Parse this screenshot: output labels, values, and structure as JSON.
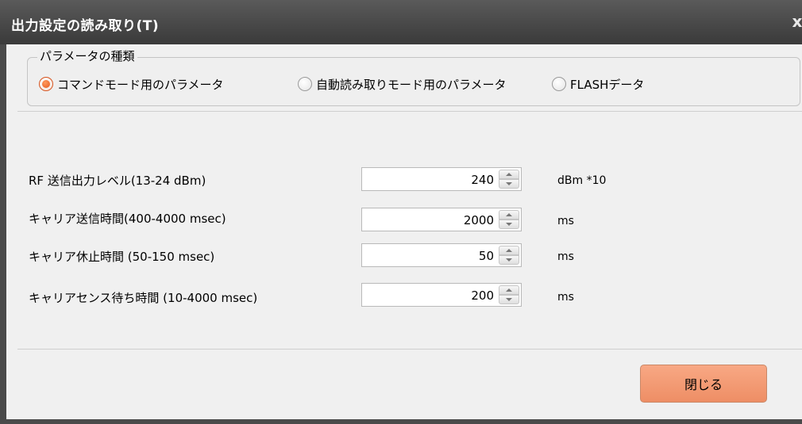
{
  "window": {
    "title": "出力設定の読み取り(T)",
    "close_glyph": "x"
  },
  "parameter_type": {
    "legend": "パラメータの種類",
    "options": [
      {
        "label": "コマンドモード用のパラメータ",
        "checked": true
      },
      {
        "label": "自動読み取りモード用のパラメータ",
        "checked": false
      },
      {
        "label": "FLASHデータ",
        "checked": false
      }
    ]
  },
  "params": [
    {
      "label": "RF 送信出力レベル(13-24 dBm)",
      "value": "240",
      "unit": "dBm *10"
    },
    {
      "label": "キャリア送信時間(400-4000 msec)",
      "value": "2000",
      "unit": "ms"
    },
    {
      "label": "キャリア休止時間 (50-150 msec)",
      "value": "50",
      "unit": "ms"
    },
    {
      "label": "キャリアセンス待ち時間 (10-4000 msec)",
      "value": "200",
      "unit": "ms"
    }
  ],
  "footer": {
    "close_button_label": "閉じる"
  },
  "colors": {
    "accent": "#ee8e65",
    "radio_checked": "#e4571e",
    "titlebar": "#3a3a3a"
  }
}
